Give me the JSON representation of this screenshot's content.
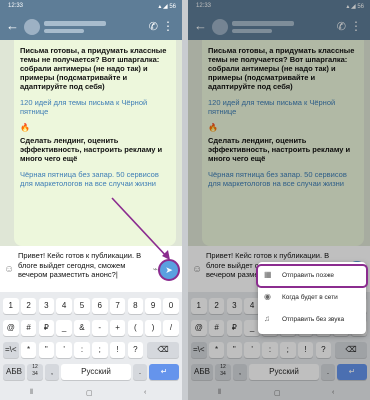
{
  "status": {
    "time": "12:33",
    "system": "▴ ◢ 56"
  },
  "chat": {
    "para1": "Письма готовы, а придумать классные темы не получается? Вот шпаргалка: собрали антимеры (не надо так) и примеры (подсматривайте и адаптируйте под себя)",
    "link1": "120 идей для темы письма к Чёрной пятнице",
    "para2": "Сделать лендинг, оценить эффективность, настроить рекламу и много чего ещё",
    "link2": "Чёрная пятница без запар. 50 сервисов для маркетологов на все случаи жизни",
    "fire": "🔥"
  },
  "input": {
    "text": "Привет! Кейс готов к публикации. В блоге выйдет сегодня, сможем вечером разместить анонс?|"
  },
  "keyboard": {
    "row1": [
      "1",
      "2",
      "3",
      "4",
      "5",
      "6",
      "7",
      "8",
      "9",
      "0"
    ],
    "row2": [
      "@",
      "#",
      "₽",
      "_",
      "&",
      "-",
      "+",
      "(",
      ")",
      "/"
    ],
    "row3": [
      "=\\<",
      "*",
      "\"",
      "'",
      ":",
      ";",
      "!",
      "?"
    ],
    "abc": "АБВ",
    "nums": "12\n34",
    "space": "Русский",
    "comma": ",",
    "dot": "."
  },
  "popup": {
    "items": [
      {
        "icon": "calendar-icon",
        "label": "Отправить позже"
      },
      {
        "icon": "user-icon",
        "label": "Когда будет в сети"
      },
      {
        "icon": "bell-off-icon",
        "label": "Отправить без звука"
      }
    ]
  },
  "colors": {
    "header": "#5e7d97",
    "accent": "#8b2c8f",
    "send": "#5aa0e0",
    "enter": "#6594ec"
  }
}
